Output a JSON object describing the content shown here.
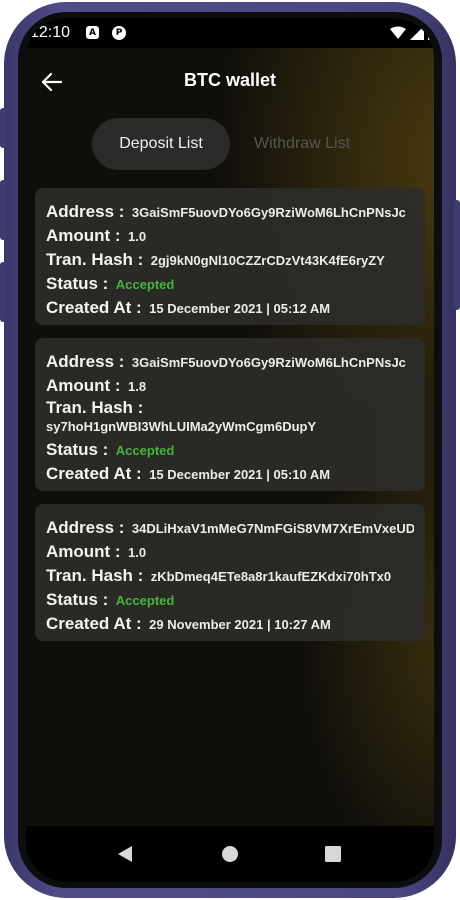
{
  "status_bar": {
    "time": "12:10",
    "notification_icons": [
      "a-icon",
      "p-icon"
    ],
    "right_icons": [
      "wifi-icon",
      "signal-icon",
      "battery-icon"
    ]
  },
  "header": {
    "title": "BTC wallet",
    "back_icon": "arrow-left-icon"
  },
  "tabs": [
    {
      "label": "Deposit List",
      "active": true
    },
    {
      "label": "Withdraw List",
      "active": false
    }
  ],
  "labels": {
    "address": "Address :",
    "amount": "Amount :",
    "hash": "Tran. Hash :",
    "status": "Status :",
    "created": "Created At :"
  },
  "deposits": [
    {
      "address": "3GaiSmF5uovDYo6Gy9RziWoM6LhCnPNsJc",
      "amount": "1.0",
      "hash": "2gj9kN0gNl10CZZrCDzVt43K4fE6ryZY",
      "status": "Accepted",
      "created_at": "15 December 2021 | 05:12 AM"
    },
    {
      "address": "3GaiSmF5uovDYo6Gy9RziWoM6LhCnPNsJc",
      "amount": "1.8",
      "hash": "sy7hoH1gnWBI3WhLUIMa2yWmCgm6DupY",
      "status": "Accepted",
      "created_at": "15 December 2021 | 05:10 AM"
    },
    {
      "address": "34DLiHxaV1mMeG7NmFGiS8VM7XrEmVxeUD",
      "amount": "1.0",
      "hash": "zKbDmeq4ETe8a8r1kaufEZKdxi70hTx0",
      "status": "Accepted",
      "created_at": "29 November 2021 | 10:27 AM"
    }
  ],
  "colors": {
    "accepted": "#46b43a",
    "phone_frame": "#4a4780",
    "card_bg": "#2c2b29",
    "active_tab": "#2b2a28"
  },
  "nav_bar": {
    "icons": [
      "back-triangle-icon",
      "home-circle-icon",
      "recents-square-icon"
    ]
  }
}
